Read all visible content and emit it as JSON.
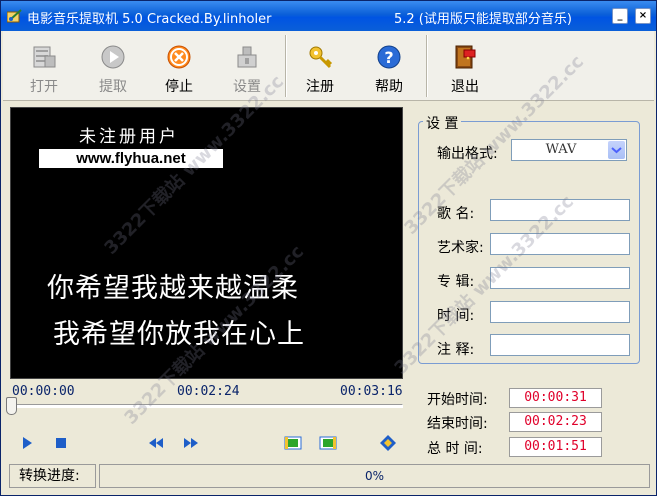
{
  "window": {
    "title": "电影音乐提取机 5.0  Cracked.By.linholer",
    "version_note": "5.2 (试用版只能提取部分音乐)",
    "buttons": {
      "minimize": "_",
      "close": "×"
    }
  },
  "toolbar": {
    "items": [
      {
        "label": "打开",
        "icon": "open-icon",
        "enabled": false
      },
      {
        "label": "提取",
        "icon": "extract-icon",
        "enabled": false
      },
      {
        "label": "停止",
        "icon": "stop-icon",
        "enabled": true
      },
      {
        "label": "设置",
        "icon": "settings-icon",
        "enabled": false
      },
      {
        "label": "注册",
        "icon": "key-icon",
        "enabled": true
      },
      {
        "label": "帮助",
        "icon": "help-icon",
        "enabled": true
      },
      {
        "label": "退出",
        "icon": "exit-icon",
        "enabled": true
      }
    ]
  },
  "video": {
    "unregistered": "未注册用户",
    "site": "www.flyhua.net",
    "lyric_line1": "你希望我越来越温柔",
    "lyric_line2": "我希望你放我在心上"
  },
  "playback": {
    "time_start": "00:00:00",
    "time_current": "00:02:24",
    "time_end": "00:03:16",
    "position_fraction": 0.0
  },
  "settings": {
    "group_title": "设 置",
    "format_label": "输出格式:",
    "format_value": "WAV",
    "song_label": "歌   名:",
    "artist_label": "艺术家:",
    "album_label": "专   辑:",
    "time_label": "时   间:",
    "comment_label": "注   释:"
  },
  "times": {
    "start_label": "开始时间:",
    "start_value": "00:00:31",
    "end_label": "结束时间:",
    "end_value": "00:02:23",
    "total_label": "总 时 间:",
    "total_value": "00:01:51"
  },
  "status": {
    "progress_label": "转换进度:",
    "progress_text": "0%"
  },
  "watermark": "3322下载站 www.3322.cc",
  "colors": {
    "title_bar": "#0054E3",
    "time_red": "#E0002A",
    "group_border": "#7A9CD3"
  }
}
